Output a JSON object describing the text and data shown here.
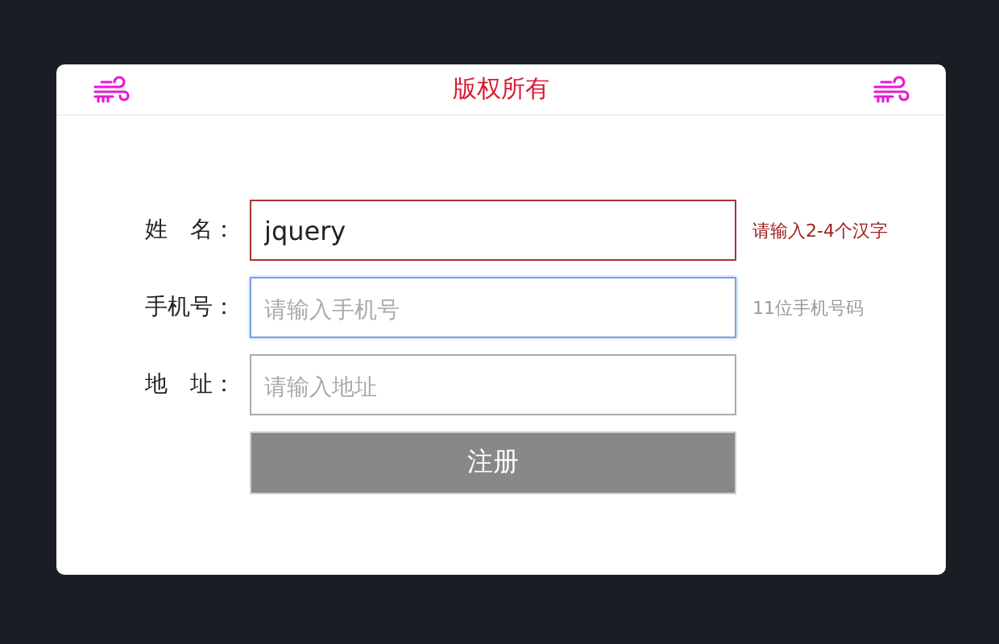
{
  "header": {
    "title": "版权所有"
  },
  "fields": [
    {
      "label": "姓　名：",
      "value": "jquery",
      "invalid": true,
      "focused": false,
      "hint": "请输入2-4个汉字"
    },
    {
      "label": "手机号：",
      "placeholder": "请输入手机号",
      "invalid": false,
      "focused": true,
      "hint": "11位手机号码"
    },
    {
      "label": "地　址：",
      "placeholder": "请输入地址",
      "invalid": false,
      "focused": false
    }
  ],
  "submit": {
    "label": "注册"
  }
}
